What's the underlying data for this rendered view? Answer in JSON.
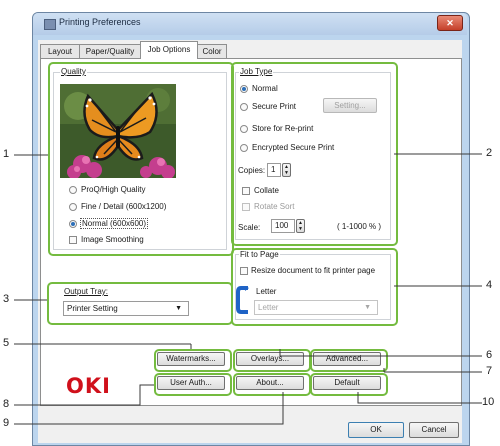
{
  "window": {
    "title": "Printing Preferences",
    "close_label": "✕"
  },
  "tabs": [
    {
      "label": "Layout"
    },
    {
      "label": "Paper/Quality"
    },
    {
      "label": "Job Options"
    },
    {
      "label": "Color"
    }
  ],
  "quality": {
    "group_label": "Quality",
    "options": [
      {
        "label": "ProQ/High Quality",
        "selected": false
      },
      {
        "label": "Fine / Detail (600x1200)",
        "selected": false
      },
      {
        "label": "Normal (600x600)",
        "selected": true
      }
    ],
    "image_smoothing_label": "Image Smoothing"
  },
  "job_type": {
    "group_label": "Job Type",
    "options": [
      {
        "label": "Normal",
        "selected": true
      },
      {
        "label": "Secure Print",
        "selected": false
      },
      {
        "label": "Store for Re-print",
        "selected": false
      },
      {
        "label": "Encrypted Secure Print",
        "selected": false
      }
    ],
    "setting_button": "Setting...",
    "copies_label": "Copies:",
    "copies_value": "1",
    "collate_label": "Collate",
    "rotate_sort_label": "Rotate Sort",
    "scale_label": "Scale:",
    "scale_value": "100",
    "scale_range": "( 1-1000 % )"
  },
  "output_tray": {
    "label": "Output Tray:",
    "value": "Printer Setting"
  },
  "fit_to_page": {
    "group_label": "Fit to Page",
    "resize_label": "Resize document to fit printer page",
    "paper_label": "Letter",
    "paper_select": "Letter"
  },
  "buttons": {
    "watermarks": "Watermarks...",
    "overlays": "Overlays...",
    "advanced": "Advanced...",
    "user_auth": "User Auth...",
    "about": "About...",
    "default": "Default",
    "ok": "OK",
    "cancel": "Cancel"
  },
  "brand": {
    "logo": "OKI",
    "color": "#d0101b"
  },
  "callouts": [
    "1",
    "2",
    "3",
    "4",
    "5",
    "6",
    "7",
    "8",
    "9",
    "10"
  ],
  "colors": {
    "highlight": "#74bb3f",
    "accent": "#2d6fb8"
  }
}
